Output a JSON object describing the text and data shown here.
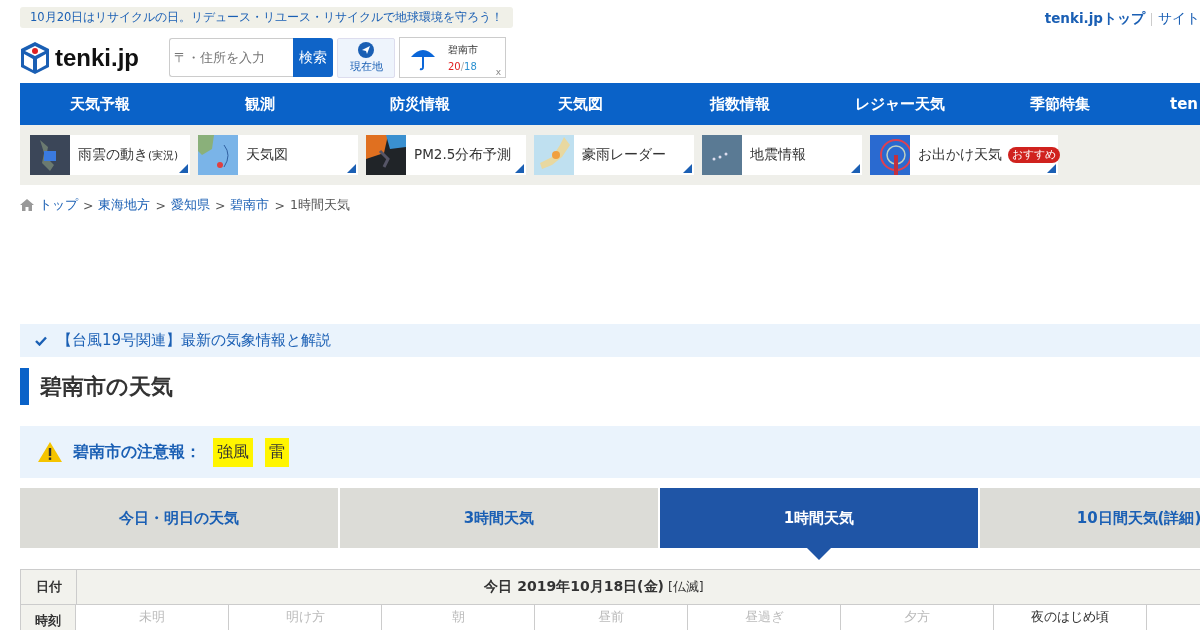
{
  "notice": "10月20日はリサイクルの日。リデュース・リユース・リサイクルで地球環境を守ろう！",
  "logo": {
    "text": "tenki.jp"
  },
  "top_links": [
    "tenki.jpトップ",
    "サイト"
  ],
  "search": {
    "placeholder": "〒・住所を入力",
    "button": "検索"
  },
  "location_button": "現在地",
  "saved_city": {
    "name": "碧南市",
    "high": "20",
    "separator": "/",
    "low": "18",
    "close": "x"
  },
  "nav": [
    "天気予報",
    "観測",
    "防災情報",
    "天気図",
    "指数情報",
    "レジャー天気",
    "季節特集",
    "ten"
  ],
  "quick_links": [
    {
      "label": "雨雲の動き",
      "sub": "(実況)"
    },
    {
      "label": "天気図"
    },
    {
      "label": "PM2.5分布予測"
    },
    {
      "label": "豪雨レーダー"
    },
    {
      "label": "地震情報"
    },
    {
      "label": "お出かけ天気",
      "badge": "おすすめ"
    }
  ],
  "breadcrumb_separator": ">",
  "breadcrumb": [
    {
      "label": "トップ",
      "link": true
    },
    {
      "label": "東海地方",
      "link": true
    },
    {
      "label": "愛知県",
      "link": true
    },
    {
      "label": "碧南市",
      "link": true
    },
    {
      "label": "1時間天気",
      "link": false
    }
  ],
  "typhoon_link": "【台風19号関連】最新の気象情報と解説",
  "page_title": "碧南市の天気",
  "advisory": {
    "label": "碧南市の注意報：",
    "items": [
      "強風",
      "雷"
    ]
  },
  "tabs": [
    {
      "label": "今日・明日の天気",
      "selected": false
    },
    {
      "label": "3時間天気",
      "selected": false
    },
    {
      "label": "1時間天気",
      "selected": true
    },
    {
      "label": "10日間天気(詳細)",
      "selected": false
    }
  ],
  "table": {
    "date_label": "日付",
    "date": "今日 2019年10月18日(金)",
    "rokuyo": "[仏滅]",
    "time_label": "時刻",
    "periods": [
      {
        "label": "未明",
        "past": true
      },
      {
        "label": "明け方",
        "past": true
      },
      {
        "label": "朝",
        "past": true
      },
      {
        "label": "昼前",
        "past": true
      },
      {
        "label": "昼過ぎ",
        "past": true
      },
      {
        "label": "夕方",
        "past": true
      },
      {
        "label": "夜のはじめ頃",
        "past": false
      }
    ]
  }
}
